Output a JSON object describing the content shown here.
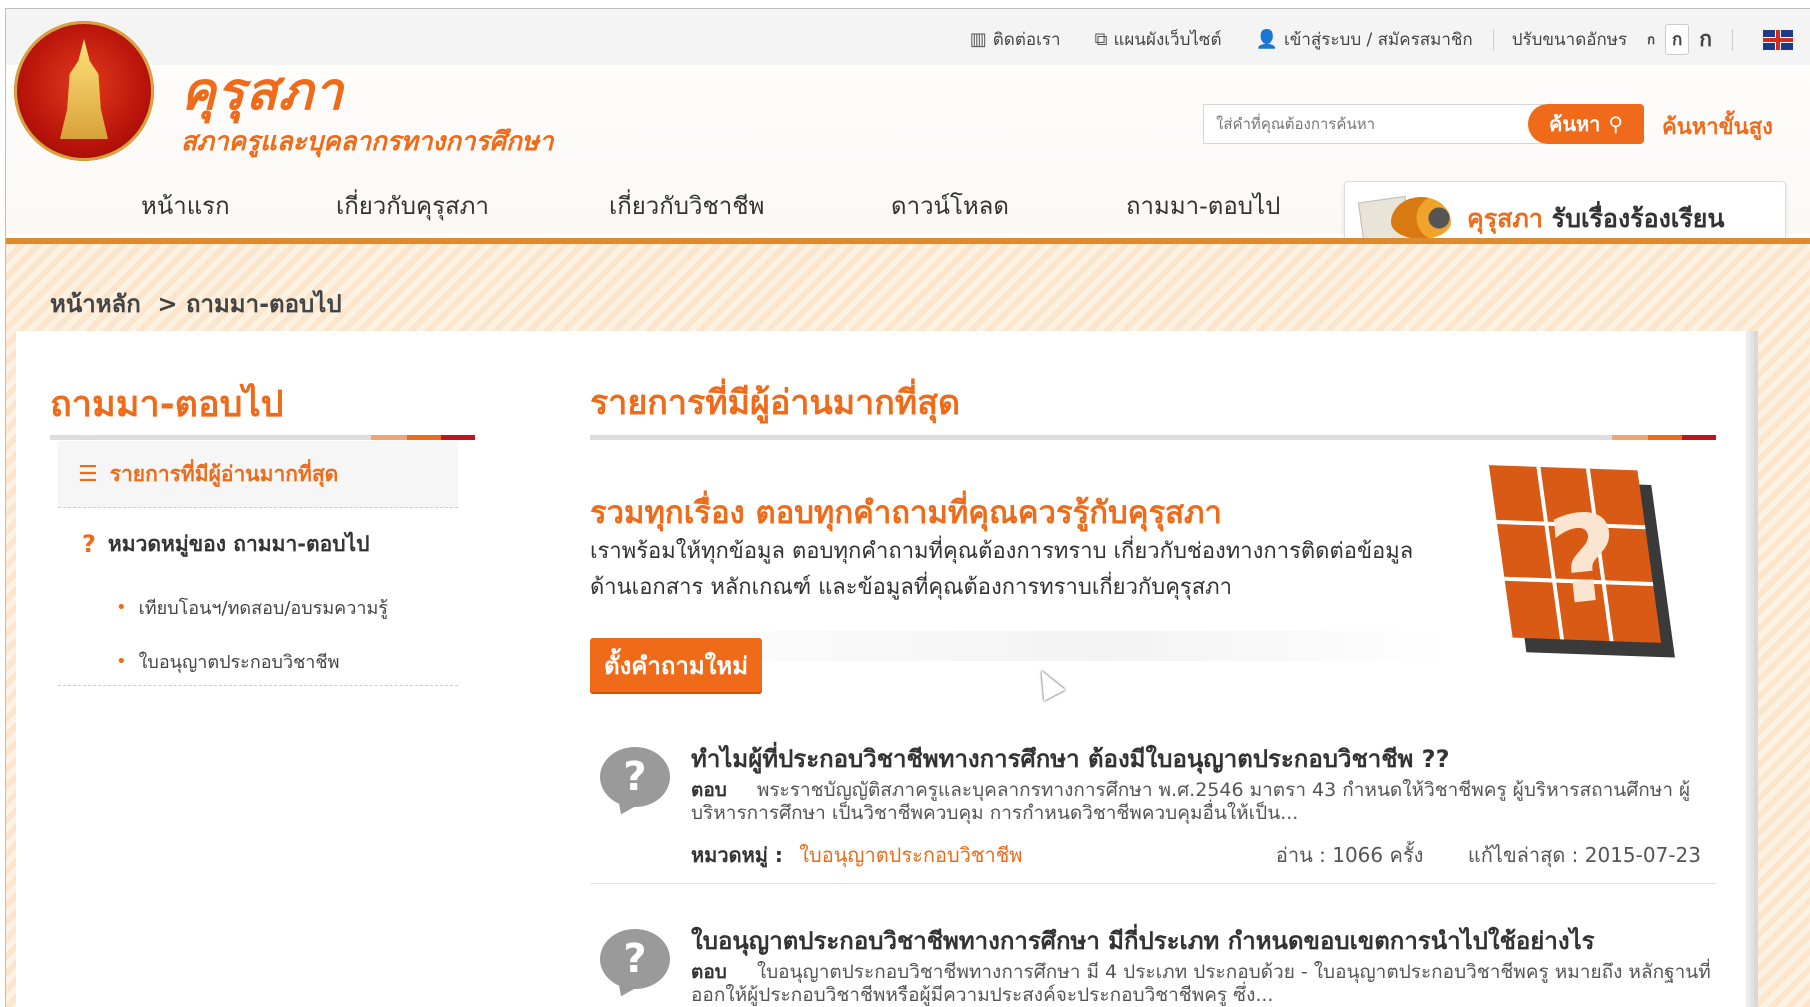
{
  "topbar": {
    "contact": "ติดต่อเรา",
    "sitemap": "แผนผังเว็บไซต์",
    "login": "เข้าสู่ระบบ / สมัครสมาชิก",
    "font_label": "ปรับขนาดอักษร",
    "font_small": "ก",
    "font_mid": "ก",
    "font_large": "ก"
  },
  "logo": {
    "title": "คุรุสภา",
    "subtitle": "สภาครูและบุคลากรทางการศึกษา"
  },
  "search": {
    "placeholder": "ใส่คำที่คุณต้องการค้นหา",
    "button": "ค้นหา",
    "advanced": "ค้นหาขั้นสูง"
  },
  "nav": {
    "items": [
      "หน้าแรก",
      "เกี่ยวกับคุรุสภา",
      "เกี่ยวกับวิชาชีพ",
      "ดาวน์โหลด",
      "ถามมา-ตอบไป"
    ],
    "complaint_a": "คุรุสภา",
    "complaint_b": "รับเรื่องร้องเรียน"
  },
  "breadcrumb": {
    "home": "หน้าหลัก",
    "current": "> ถามมา-ตอบไป"
  },
  "sidebar": {
    "title": "ถามมา-ตอบไป",
    "active_item": "รายการที่มีผู้อ่านมากที่สุด",
    "category_header": "หมวดหมู่ของ ถามมา-ตอบไป",
    "subitems": [
      "เทียบโอนฯ/ทดสอบ/อบรมความรู้",
      "ใบอนุญาตประกอบวิชาชีพ"
    ]
  },
  "main": {
    "title": "รายการที่มีผู้อ่านมากที่สุด",
    "intro_head": "รวมทุกเรื่อง  ตอบทุกคำถามที่คุณควรรู้กับคุรุสภา",
    "intro_line1": "เราพร้อมให้ทุกข้อมูล ตอบทุกคำถามที่คุณต้องการทราบ เกี่ยวกับช่องทางการติดต่อข้อมูล",
    "intro_line2": "ด้านเอกสาร หลักเกณฑ์ และข้อมูลที่คุณต้องการทราบเกี่ยวกับคุรุสภา",
    "ask_button": "ตั้งคำถามใหม่",
    "questions": [
      {
        "title": "ทำไมผู้ที่ประกอบวิชาชีพทางการศึกษา ต้องมีใบอนุญาตประกอบวิชาชีพ ??",
        "answer_label": "ตอบ",
        "answer": "พระราชบัญญัติสภาครูและบุคลากรทางการศึกษา พ.ศ.2546 มาตรา 43 กำหนดให้วิชาชีพครู ผู้บริหารสถานศึกษา ผู้บริหารการศึกษา เป็นวิชาชีพควบคุม การกำหนดวิชาชีพควบคุมอื่นให้เป็น...",
        "category_label": "หมวดหมู่ :",
        "category": "ใบอนุญาตประกอบวิชาชีพ",
        "reads": "อ่าน :  1066 ครั้ง",
        "updated": "แก้ไขล่าสุด :  2015-07-23"
      },
      {
        "title": "ใบอนุญาตประกอบวิชาชีพทางการศึกษา มีกี่ประเภท กำหนดขอบเขตการนำไปใช้อย่างไร",
        "answer_label": "ตอบ",
        "answer": "ใบอนุญาตประกอบวิชาชีพทางการศึกษา มี 4 ประเภท ประกอบด้วย     - ใบอนุญาตประกอบวิชาชีพครู หมายถึง หลักฐานที่ออกให้ผู้ประกอบวิชาชีพหรือผู้มีความประสงค์จะประกอบวิชาชีพครู ซึ่ง..."
      }
    ]
  },
  "colors": {
    "accent": "#ef6b1a",
    "dark_red": "#c1131b"
  }
}
